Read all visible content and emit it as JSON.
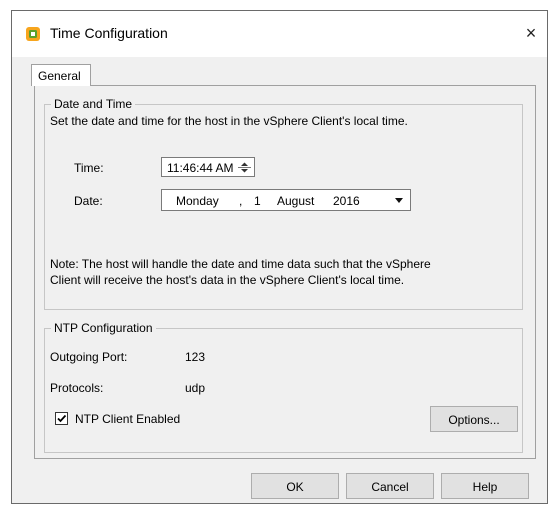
{
  "window": {
    "title": "Time Configuration",
    "close_glyph": "×"
  },
  "tabs": [
    {
      "label": "General",
      "selected": true
    }
  ],
  "date_time": {
    "legend": "Date and Time",
    "description": "Set the date and time for the host in the vSphere Client's local time.",
    "time_label": "Time:",
    "time_value": "11:46:44 AM",
    "date_label": "Date:",
    "date_weekday": "Monday",
    "date_sep": ",",
    "date_day": "1",
    "date_month": "August",
    "date_year": "2016",
    "note_line1": "Note: The host will handle the date and time data such that the vSphere",
    "note_line2": "Client will receive the host's data in the vSphere Client's local time."
  },
  "ntp": {
    "legend": "NTP Configuration",
    "port_label": "Outgoing Port:",
    "port_value": "123",
    "protocols_label": "Protocols:",
    "protocols_value": "udp",
    "client_enabled_label": "NTP Client Enabled",
    "client_enabled": true,
    "options_label": "Options..."
  },
  "buttons": {
    "ok": "OK",
    "cancel": "Cancel",
    "help": "Help"
  },
  "icons": {
    "app": "vsphere-app-icon",
    "close": "close-icon",
    "spinner": "spinner-icon",
    "dropdown": "chevron-down-icon",
    "check": "checkmark-icon"
  },
  "colors": {
    "icon_orange": "#f7a51d",
    "icon_green": "#5aa02c",
    "dialog_bg": "#f0f0f0"
  }
}
